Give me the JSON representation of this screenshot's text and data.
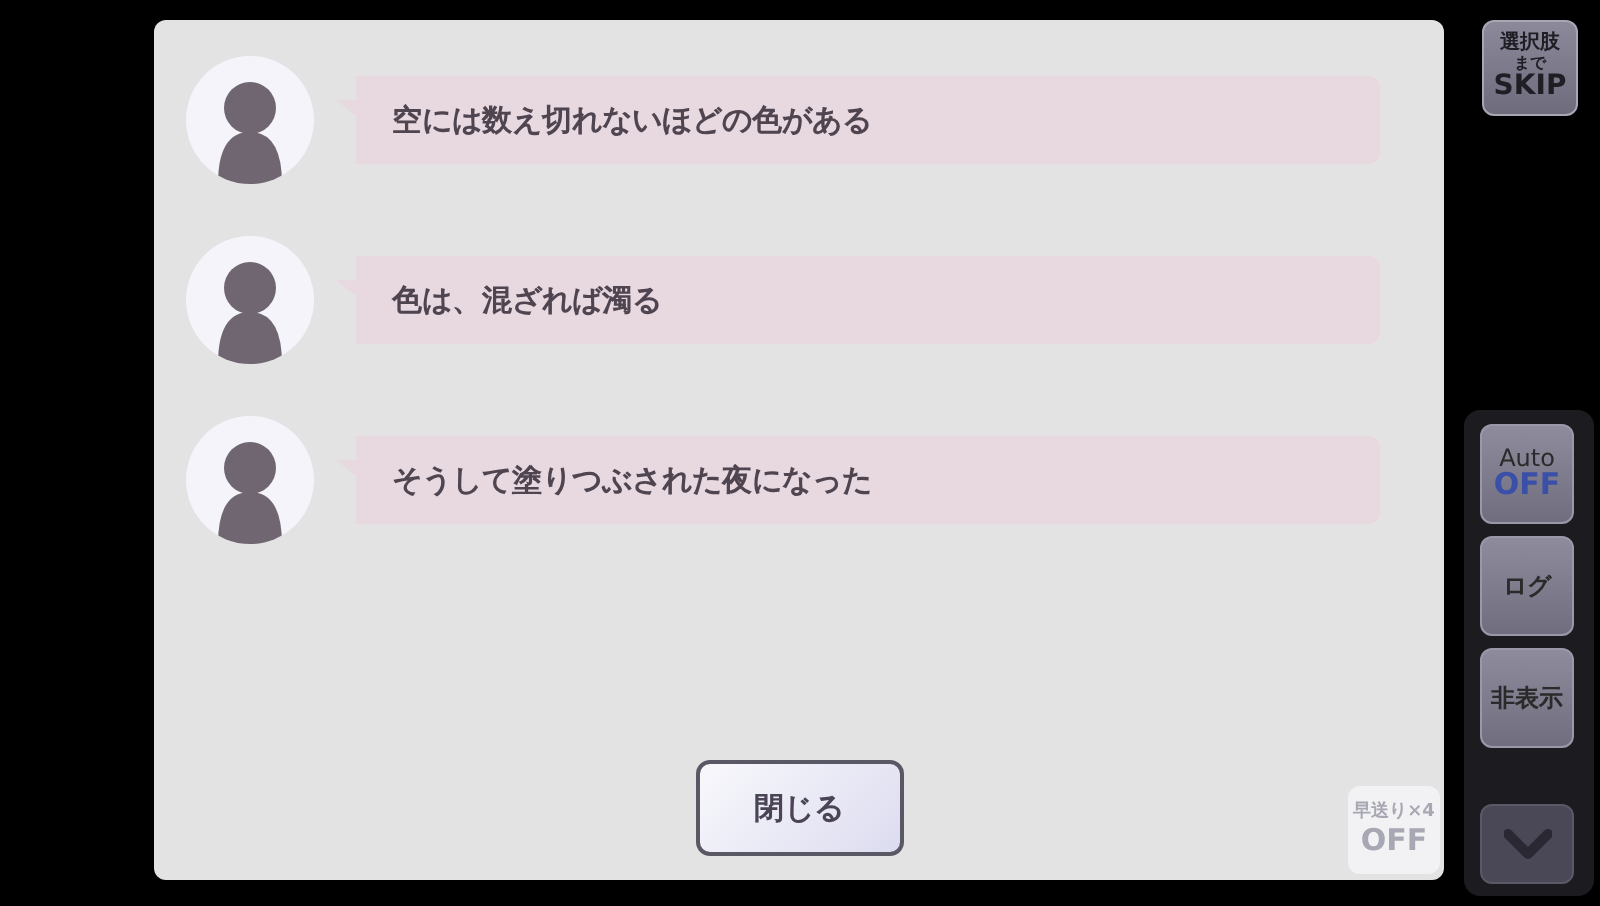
{
  "messages": [
    {
      "text": "空には数え切れないほどの色がある"
    },
    {
      "text": "色は、混ざれば濁る"
    },
    {
      "text": "そうして塗りつぶされた夜になった"
    }
  ],
  "close_button": "閉じる",
  "skip_button": {
    "line1": "選択肢",
    "line2": "まで",
    "line3": "SKIP"
  },
  "fast_forward": {
    "label": "早送り×4",
    "state": "OFF"
  },
  "side_menu": [
    {
      "kind": "toggle",
      "label": "Auto",
      "state": "OFF"
    },
    {
      "kind": "text",
      "label": "ログ"
    },
    {
      "kind": "text",
      "label": "非表示"
    },
    {
      "kind": "chevron"
    }
  ]
}
